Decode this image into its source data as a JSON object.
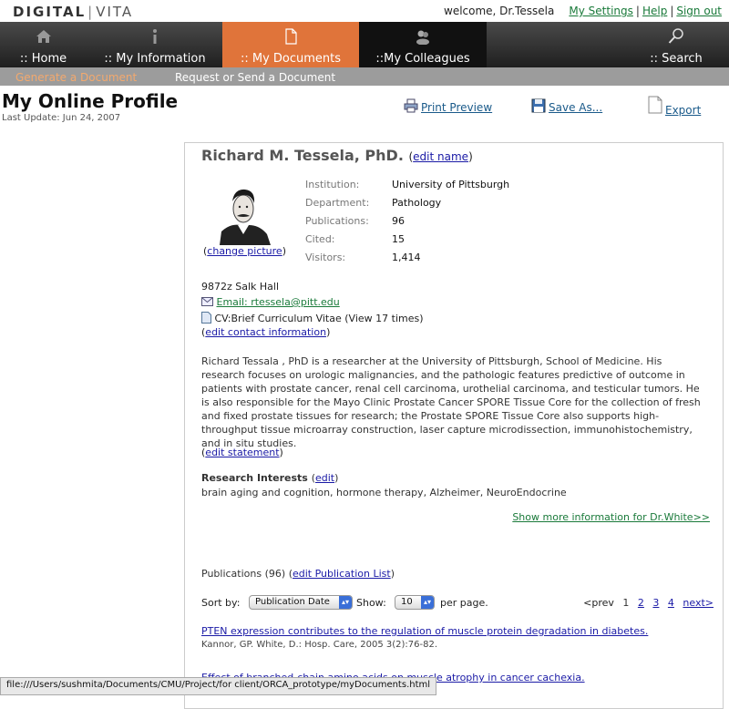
{
  "brand": {
    "left": "DIGITAL",
    "right": "VITA"
  },
  "header": {
    "welcome": "welcome, Dr.Tessela",
    "links": [
      "My Settings",
      "Help",
      "Sign out"
    ]
  },
  "nav": {
    "home": ":: Home",
    "info": ":: My Information",
    "docs": ":: My Documents",
    "colleagues": "::My Colleagues",
    "search": ":: Search"
  },
  "subnav": {
    "generate": "Generate a Document",
    "request": "Request or Send a Document"
  },
  "page": {
    "title": "My Online Profile",
    "last_update_label": "Last Update:",
    "last_update": "Jun 24, 2007"
  },
  "tools": {
    "print": "Print Preview",
    "save": "Save As...",
    "export": "Export"
  },
  "profile": {
    "name": "Richard M. Tessela, PhD.",
    "edit_name": "edit name",
    "change_picture": "change picture",
    "fields": {
      "institution": {
        "k": "Institution:",
        "v": "University of Pittsburgh"
      },
      "department": {
        "k": "Department:",
        "v": "Pathology"
      },
      "publications": {
        "k": "Publications:",
        "v": "96"
      },
      "cited": {
        "k": "Cited:",
        "v": "15"
      },
      "visitors": {
        "k": "Visitors:",
        "v": "1,414"
      }
    },
    "address": "9872z Salk Hall",
    "email": "Email: rtessela@pitt.edu",
    "cv": "CV:Brief Curriculum Vitae (View 17 times)",
    "edit_contact": "edit contact information",
    "statement": "Richard Tessala , PhD is a researcher at the University of Pittsburgh, School of Medicine. His research focuses on urologic malignancies, and the pathologic features predictive of outcome in patients with prostate cancer, renal cell carcinoma, urothelial carcinoma, and testicular tumors. He is also responsible for the Mayo Clinic Prostate Cancer SPORE Tissue Core for the collection of fresh and fixed prostate tissues for research; the Prostate SPORE Tissue Core also supports high-throughput tissue microarray construction, laser capture microdissection, immunohistochemistry, and in situ studies.",
    "edit_statement": "edit statement",
    "interests_label": "Research Interests",
    "interests_edit": "edit",
    "interests": "brain aging and cognition, hormone therapy, Alzheimer, NeuroEndocrine",
    "show_more": "Show more information for Dr.White>>"
  },
  "publications": {
    "label": "Publications (96)",
    "edit_list": "edit Publication List",
    "sort_label": "Sort by:",
    "sort_value": "Publication Date",
    "show_label": "Show:",
    "show_value": "10",
    "per_page": "per page.",
    "prev": "<prev",
    "pages": [
      "1",
      "2",
      "3",
      "4"
    ],
    "next": "next>",
    "items": [
      {
        "title": "PTEN expression contributes to the regulation of muscle protein degradation in diabetes.",
        "citation": "Kannor, GP. White, D.: Hosp. Care, 2005 3(2):76-82."
      },
      {
        "title": "Effect of branched-chain amino acids on muscle atrophy in cancer cachexia."
      }
    ]
  },
  "status_url": "file:///Users/sushmita/Documents/CMU/Project/for client/ORCA_prototype/myDocuments.html"
}
